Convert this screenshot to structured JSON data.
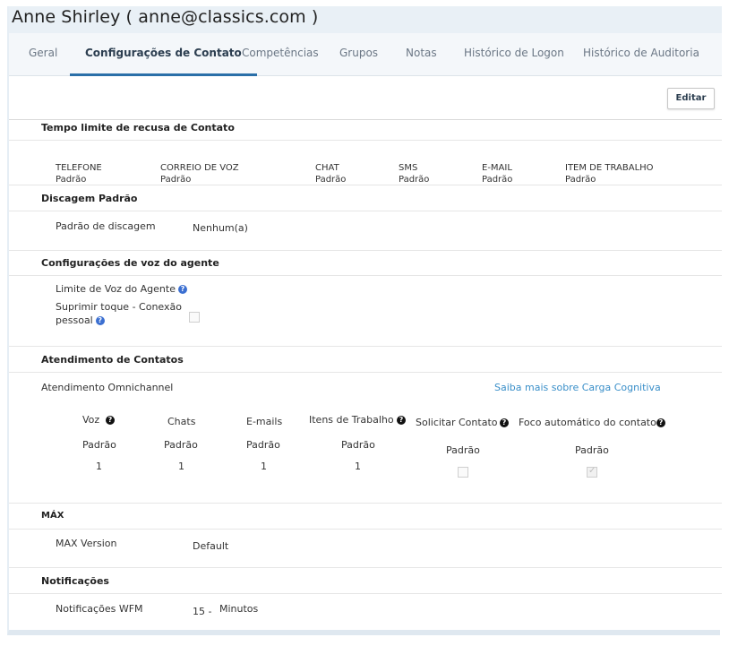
{
  "header": {
    "title": "Anne Shirley ( anne@classics.com )"
  },
  "tabs": [
    {
      "label": "Geral"
    },
    {
      "label": "Configurações de Contato"
    },
    {
      "label": "Competências"
    },
    {
      "label": "Grupos"
    },
    {
      "label": "Notas"
    },
    {
      "label": "Histórico de Logon"
    },
    {
      "label": "Histórico de Auditoria"
    }
  ],
  "toolbar": {
    "edit_label": "Editar"
  },
  "refusal_timeout": {
    "title": "Tempo limite de recusa de Contato",
    "columns": [
      {
        "label": "TELEFONE",
        "value": "Padrão"
      },
      {
        "label": "CORREIO DE VOZ",
        "value": "Padrão"
      },
      {
        "label": "CHAT",
        "value": "Padrão"
      },
      {
        "label": "SMS",
        "value": "Padrão"
      },
      {
        "label": "E-MAIL",
        "value": "Padrão"
      },
      {
        "label": "ITEM DE TRABALHO",
        "value": "Padrão"
      }
    ]
  },
  "dialing": {
    "title": "Discagem Padrão",
    "label": "Padrão de discagem",
    "value": "Nenhum(a)"
  },
  "voice": {
    "title": "Configurações de voz do agente",
    "voice_limit_label": "Limite de Voz do Agente",
    "suppress_ring_label_line1": "Suprimir toque - Conexão",
    "suppress_ring_label_line2": "pessoal",
    "suppress_ring_checked": false
  },
  "contact_handling": {
    "title": "Atendimento de Contatos",
    "omnichannel_label": "Atendimento Omnichannel",
    "cognitive_link": "Saiba mais sobre Carga Cognitiva",
    "columns": [
      {
        "header": "Voz",
        "default": "Padrão",
        "value": "1"
      },
      {
        "header": "Chats",
        "default": "Padrão",
        "value": "1"
      },
      {
        "header": "E-mails",
        "default": "Padrão",
        "value": "1"
      },
      {
        "header": "Itens de Trabalho",
        "default": "Padrão",
        "value": "1"
      }
    ],
    "request_contact": {
      "header": "Solicitar Contato",
      "default": "Padrão",
      "checked": false
    },
    "auto_focus": {
      "header": "Foco automático do contato",
      "default": "Padrão",
      "checked": true
    }
  },
  "max": {
    "title": "MÁX",
    "label": "MAX Version",
    "value": "Default"
  },
  "notifications": {
    "title": "Notificações",
    "label": "Notificações WFM",
    "value": "15 -",
    "unit": "Minutos"
  },
  "icons": {
    "help_blue": "help-circle-icon",
    "help_black": "help-circle-icon"
  },
  "colors": {
    "accent": "#2a6fa8",
    "link": "#3a8fc9",
    "help_blue": "#3b6fd1"
  }
}
